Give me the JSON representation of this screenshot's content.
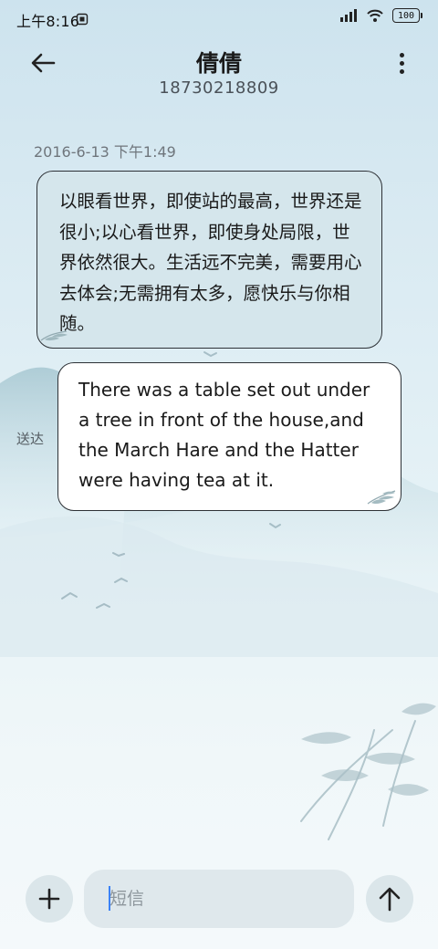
{
  "status_bar": {
    "time": "上午8:16",
    "battery_level": "100",
    "icons": [
      "sim-icon",
      "signal-icon",
      "wifi-icon",
      "battery-icon"
    ]
  },
  "header": {
    "back_icon": "arrow-left-icon",
    "contact_name": "倩倩",
    "phone_number": "18730218809",
    "more_icon": "more-vertical-icon"
  },
  "conversation": {
    "timestamp": "2016-6-13 下午1:49",
    "received_message": "以眼看世界，即使站的最高，世界还是很小;以心看世界，即使身处局限，世界依然很大。生活远不完美，需要用心去体会;无需拥有太多，愿快乐与你相随。",
    "sent_message": "There was a table set out under a tree in front of the house,and the March Hare and the Hatter were having tea at it.",
    "delivered_label": "送达"
  },
  "input_bar": {
    "add_icon": "plus-icon",
    "placeholder": "短信",
    "send_icon": "arrow-up-icon"
  },
  "colors": {
    "background_top": "#cde3ee",
    "background_bottom": "#f4f9fb",
    "received_bubble": "#d5e6ec",
    "sent_bubble": "#ffffff",
    "cursor": "#3b82f6"
  }
}
